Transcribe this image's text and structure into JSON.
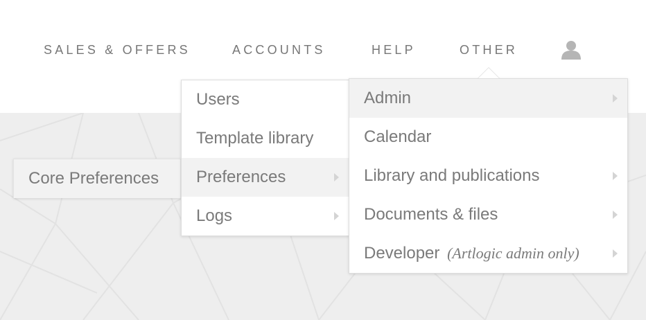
{
  "nav": {
    "sales_offers": "SALES & OFFERS",
    "accounts": "ACCOUNTS",
    "help": "HELP",
    "other": "OTHER",
    "user_icon": "user-icon"
  },
  "menu_main": {
    "items": [
      {
        "label": "Users",
        "has_submenu": false
      },
      {
        "label": "Template library",
        "has_submenu": false
      },
      {
        "label": "Preferences",
        "has_submenu": true,
        "active": true
      },
      {
        "label": "Logs",
        "has_submenu": true
      }
    ]
  },
  "menu_core": {
    "items": [
      {
        "label": "Core Preferences"
      }
    ]
  },
  "menu_other": {
    "items": [
      {
        "label": "Admin",
        "has_submenu": true,
        "active": true
      },
      {
        "label": "Calendar",
        "has_submenu": false
      },
      {
        "label": "Library and publications",
        "has_submenu": true
      },
      {
        "label": "Documents & files",
        "has_submenu": true
      },
      {
        "label": "Developer",
        "note": "(Artlogic admin only)",
        "has_submenu": true
      }
    ]
  },
  "colors": {
    "nav_text": "#777777",
    "menu_text": "#7a7a7a",
    "active_bg": "#f2f2f2",
    "page_bg_pattern": "#eeeeee"
  }
}
